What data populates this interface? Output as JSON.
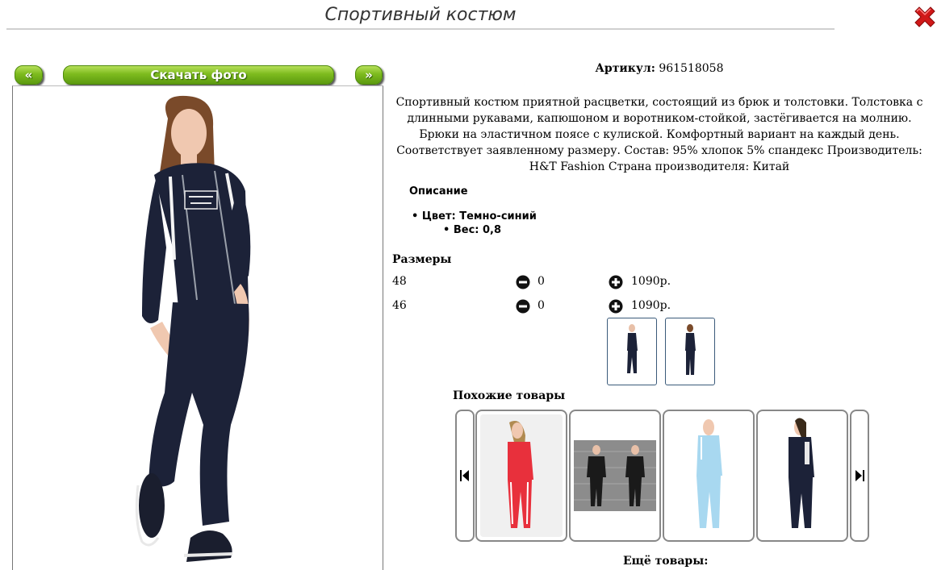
{
  "title": "Спортивный костюм",
  "nav": {
    "prev_label": "«",
    "download_label": "Скачать фото",
    "next_label": "»"
  },
  "product": {
    "sku_label": "Артикул:",
    "sku_value": "961518058",
    "description": "Спортивный костюм приятной расцветки, состоящий из брюк и толстовки. Толстовка с длинными рукавами, капюшоном и воротником-стойкой, застёгивается на молнию. Брюки на эластичном поясе с кулиской. Комфортный вариант на каждый день. Соответствует заявленному размеру. Состав: 95% хлопок 5% спандекс Производитель: H&T Fashion Страна производителя: Китай",
    "desc_heading": "Описание",
    "attr_color": "Цвет: Темно-синий",
    "attr_weight": "Вес: 0,8"
  },
  "sizes": {
    "heading": "Размеры",
    "rows": [
      {
        "size": "48",
        "qty": "0",
        "price": "1090р."
      },
      {
        "size": "46",
        "qty": "0",
        "price": "1090р."
      }
    ]
  },
  "similar": {
    "heading": "Похожие товары"
  },
  "more": {
    "heading": "Ещё товары:"
  },
  "colors": {
    "accent_green": "#7dbb1e",
    "close_red": "#d01818",
    "suit_navy": "#1c2238",
    "red_suit": "#e8303c",
    "light_blue_suit": "#a8d8f0"
  },
  "icons": [
    "close-icon",
    "minus-circle-icon",
    "plus-circle-icon",
    "first-icon",
    "last-icon"
  ]
}
